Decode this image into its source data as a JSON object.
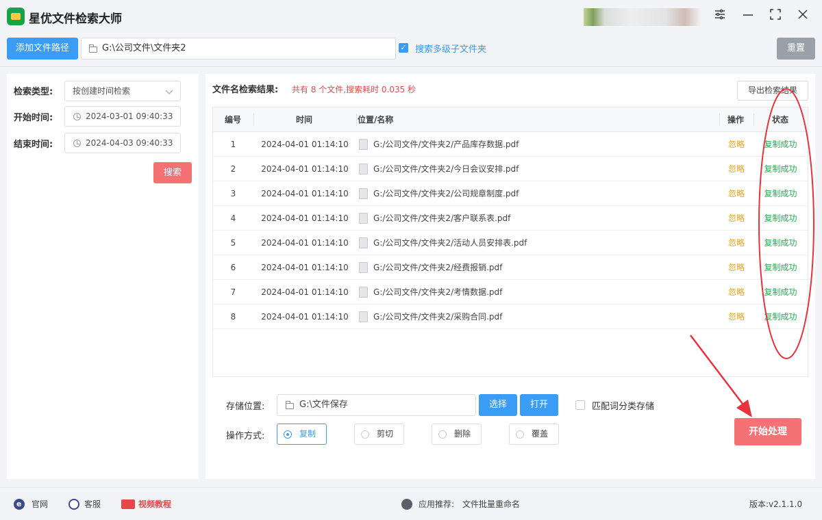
{
  "app": {
    "title": "星优文件检索大师"
  },
  "toolbar": {
    "add_path_label": "添加文件路径",
    "path_value": "G:\\公司文件\\文件夹2",
    "subfolder_label": "搜索多级子文件夹",
    "subfolder_checked": true,
    "reset_label": "重置"
  },
  "left": {
    "type_label": "检索类型:",
    "type_value": "按创建时间检索",
    "start_label": "开始时间:",
    "start_value": "2024-03-01 09:40:33",
    "end_label": "结束时间:",
    "end_value": "2024-04-03 09:40:33",
    "search_label": "搜索"
  },
  "results": {
    "title": "文件名检索结果:",
    "summary": "共有 8 个文件,搜索耗时 0.035 秒",
    "export_label": "导出检索结果",
    "columns": {
      "no": "编号",
      "time": "时间",
      "path": "位置/名称",
      "op": "操作",
      "status": "状态"
    },
    "rows": [
      {
        "no": "1",
        "time": "2024-04-01 01:14:10",
        "path": "G:/公司文件/文件夹2/产品库存数据.pdf",
        "op": "忽略",
        "status": "复制成功"
      },
      {
        "no": "2",
        "time": "2024-04-01 01:14:10",
        "path": "G:/公司文件/文件夹2/今日会议安排.pdf",
        "op": "忽略",
        "status": "复制成功"
      },
      {
        "no": "3",
        "time": "2024-04-01 01:14:10",
        "path": "G:/公司文件/文件夹2/公司规章制度.pdf",
        "op": "忽略",
        "status": "复制成功"
      },
      {
        "no": "4",
        "time": "2024-04-01 01:14:10",
        "path": "G:/公司文件/文件夹2/客户联系表.pdf",
        "op": "忽略",
        "status": "复制成功"
      },
      {
        "no": "5",
        "time": "2024-04-01 01:14:10",
        "path": "G:/公司文件/文件夹2/活动人员安排表.pdf",
        "op": "忽略",
        "status": "复制成功"
      },
      {
        "no": "6",
        "time": "2024-04-01 01:14:10",
        "path": "G:/公司文件/文件夹2/经费报销.pdf",
        "op": "忽略",
        "status": "复制成功"
      },
      {
        "no": "7",
        "time": "2024-04-01 01:14:10",
        "path": "G:/公司文件/文件夹2/考情数据.pdf",
        "op": "忽略",
        "status": "复制成功"
      },
      {
        "no": "8",
        "time": "2024-04-01 01:14:10",
        "path": "G:/公司文件/文件夹2/采购合同.pdf",
        "op": "忽略",
        "status": "复制成功"
      }
    ]
  },
  "storage": {
    "label": "存储位置:",
    "value": "G:\\文件保存",
    "choose_label": "选择",
    "open_label": "打开",
    "match_label": "匹配词分类存储",
    "match_checked": false
  },
  "operation": {
    "label": "操作方式:",
    "options": [
      "复制",
      "剪切",
      "删除",
      "覆盖"
    ],
    "selected": "复制"
  },
  "start_label": "开始处理",
  "footer": {
    "site": "官网",
    "service": "客服",
    "video": "视频教程",
    "rec_label": "应用推荐:",
    "rec_value": "文件批量重命名",
    "version": "版本:v2.1.1.0"
  },
  "colors": {
    "accent": "#3b9cf5",
    "danger": "#f47174",
    "success": "#22b24c",
    "warning": "#f0a020",
    "annotation": "#e8323c"
  }
}
